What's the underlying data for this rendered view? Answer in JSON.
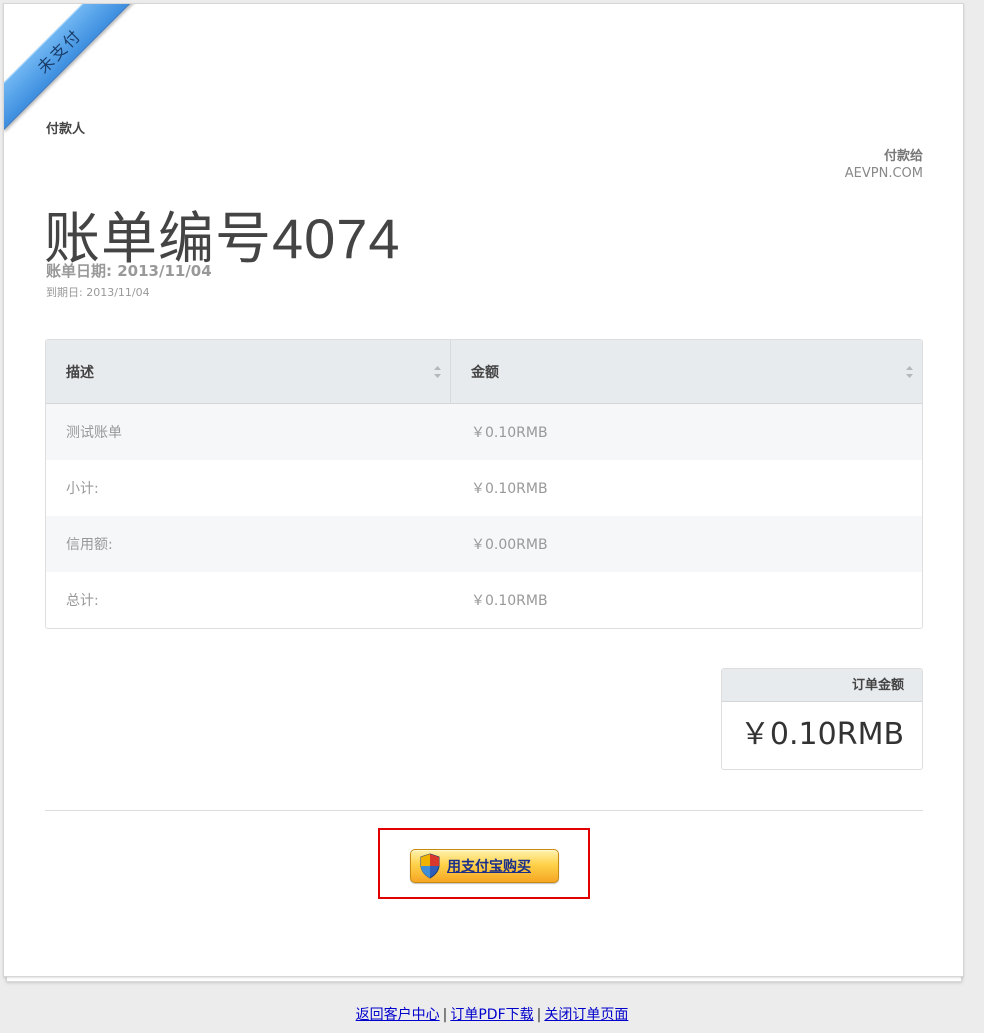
{
  "ribbon": {
    "status": "未支付"
  },
  "payer": {
    "label": "付款人"
  },
  "payto": {
    "label": "付款给",
    "company": "AEVPN.COM"
  },
  "invoice": {
    "title_prefix": "账单编号",
    "number": "4074",
    "date": "账单日期: 2013/11/04",
    "due_date": "到期日: 2013/11/04"
  },
  "items_table": {
    "headers": [
      "描述",
      "金额"
    ],
    "rows": [
      {
        "desc": "测试账单",
        "amount": "￥0.10RMB"
      },
      {
        "desc": "小计:",
        "amount": "￥0.10RMB"
      },
      {
        "desc": "信用额:",
        "amount": "￥0.00RMB"
      },
      {
        "desc": "总计:",
        "amount": "￥0.10RMB"
      }
    ]
  },
  "order_total": {
    "label": "订单金额",
    "value": "￥0.10RMB"
  },
  "alipay": {
    "label": "用支付宝购买"
  },
  "footer": {
    "links": [
      "返回客户中心",
      "订单PDF下载",
      "关闭订单页面"
    ],
    "separator": "|"
  },
  "colors": {
    "ribbon": "#4a9ae6",
    "highlight_border": "#e00000",
    "link": "#0000cc",
    "button": "#ffd24a"
  }
}
